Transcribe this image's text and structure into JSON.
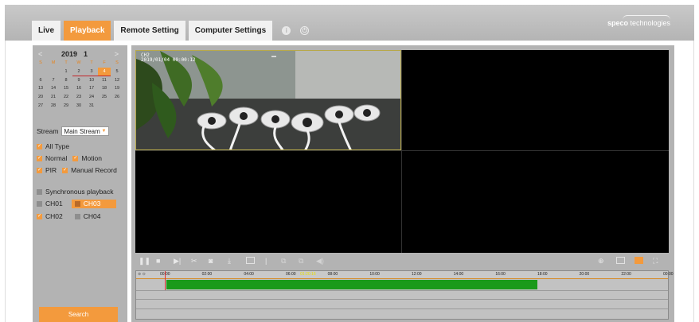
{
  "tabs": [
    {
      "label": "Live",
      "active": false
    },
    {
      "label": "Playback",
      "active": true
    },
    {
      "label": "Remote Setting",
      "active": false
    },
    {
      "label": "Computer Settings",
      "active": false
    }
  ],
  "header_icons": [
    "info-icon",
    "power-icon"
  ],
  "logo": {
    "bold": "speco",
    "rest": " technologies"
  },
  "colors": {
    "accent": "#f39a3d",
    "panel": "#b3b3b3",
    "record": "#1a9a1a"
  },
  "calendar": {
    "year": "2019",
    "month": "1",
    "prev": "<",
    "next": ">",
    "weekdays": [
      "S",
      "M",
      "T",
      "W",
      "T",
      "F",
      "S"
    ],
    "weeks": [
      [
        "",
        "",
        "1",
        "2",
        "3",
        "4",
        "5"
      ],
      [
        "6",
        "7",
        "8",
        "9",
        "10",
        "11",
        "12"
      ],
      [
        "13",
        "14",
        "15",
        "16",
        "17",
        "18",
        "19"
      ],
      [
        "20",
        "21",
        "22",
        "23",
        "24",
        "25",
        "26"
      ],
      [
        "27",
        "28",
        "29",
        "30",
        "31",
        "",
        ""
      ]
    ],
    "selected": "4",
    "has_record": [
      "2",
      "3",
      "4"
    ]
  },
  "stream": {
    "label": "Stream",
    "value": "Main Stream"
  },
  "record_types": {
    "all": {
      "label": "All Type",
      "checked": true
    },
    "normal": {
      "label": "Normal",
      "checked": true
    },
    "motion": {
      "label": "Motion",
      "checked": true
    },
    "pir": {
      "label": "PIR",
      "checked": true
    },
    "manual": {
      "label": "Manual Record",
      "checked": true
    }
  },
  "sync_playback": {
    "label": "Synchronous playback",
    "checked": false
  },
  "channels": [
    {
      "label": "CH01",
      "checked": false
    },
    {
      "label": "CH03",
      "checked": false
    },
    {
      "label": "CH02",
      "checked": true
    },
    {
      "label": "CH04",
      "checked": false
    }
  ],
  "search_label": "Search",
  "osd": {
    "line1": "CH2",
    "line2": "2019/01/04 00:00:12",
    "mark": "▬"
  },
  "controls": [
    "pause-icon",
    "stop-icon",
    "step-forward-icon",
    "clip-icon",
    "snapshot-icon",
    "download-icon",
    "fullscreen-cell-icon",
    "separator",
    "window-1-icon",
    "window-2-icon",
    "volume-icon"
  ],
  "controls_right": [
    "zoom-icon",
    "layout-1-icon",
    "layout-4-icon",
    "fullscreen-icon"
  ],
  "timeline": {
    "zoom_text": "⊕ ⊖",
    "ticks": [
      "00:00",
      "02:00",
      "04:00",
      "06:00",
      "08:00",
      "10:00",
      "12:00",
      "14:00",
      "16:00",
      "18:00",
      "20:00",
      "22:00",
      "00:00"
    ],
    "cursor_label": "01:20:16",
    "record_start_hours": 0.1,
    "record_end_hours": 17.8
  }
}
